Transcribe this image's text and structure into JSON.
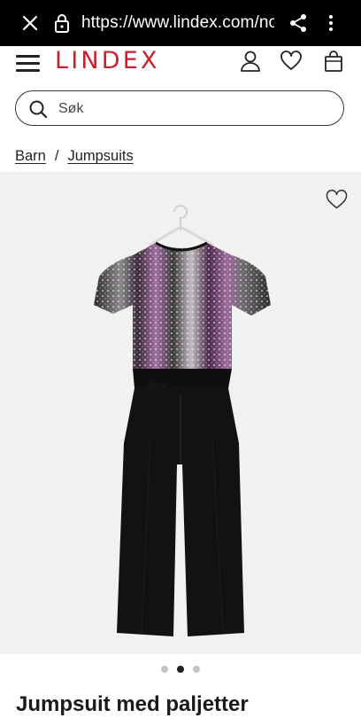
{
  "browser": {
    "url": "https://www.lindex.com/no/p",
    "icons": [
      "close-icon",
      "lock-icon",
      "share-icon",
      "more-vert-icon"
    ]
  },
  "header": {
    "logo": "LINDEX",
    "brand_color": "#c8202f",
    "icons": [
      "menu-icon",
      "account-icon",
      "heart-icon",
      "bag-icon"
    ]
  },
  "search": {
    "placeholder": "Søk",
    "value": ""
  },
  "breadcrumb": {
    "items": [
      "Barn",
      "Jumpsuits"
    ],
    "separator": "/"
  },
  "gallery": {
    "image_count": 3,
    "active_index": 1
  },
  "product": {
    "title": "Jumpsuit med paljetter"
  }
}
